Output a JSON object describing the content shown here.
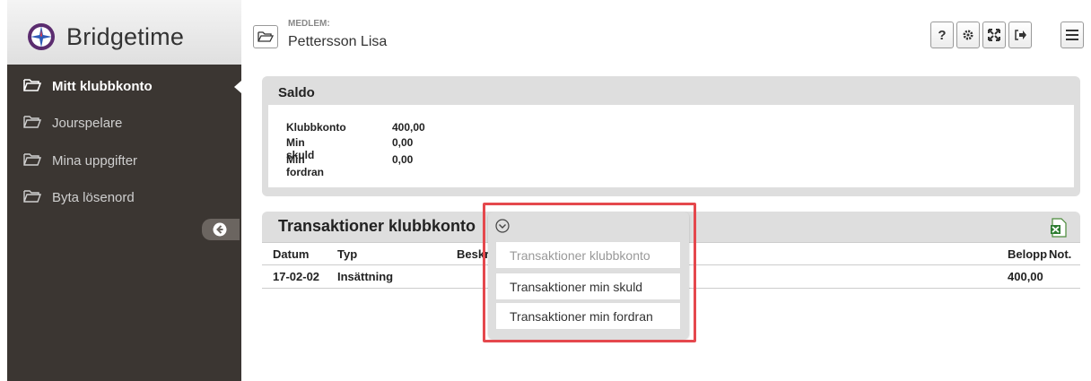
{
  "app": {
    "name": "Bridgetime"
  },
  "member": {
    "label": "MEDLEM:",
    "name": "Pettersson Lisa"
  },
  "toolbar": {
    "help_label": "?"
  },
  "sidebar": {
    "items": [
      {
        "label": "Mitt klubbkonto",
        "active": true
      },
      {
        "label": "Jourspelare"
      },
      {
        "label": "Mina uppgifter"
      },
      {
        "label": "Byta lösenord"
      }
    ]
  },
  "saldo": {
    "title": "Saldo",
    "rows": [
      {
        "label": "Klubbkonto",
        "value": "400,00"
      },
      {
        "label": "Min skuld",
        "value": "0,00"
      },
      {
        "label": "Min fordran",
        "value": "0,00"
      }
    ]
  },
  "transactions": {
    "title": "Transaktioner klubbkonto",
    "columns": {
      "date": "Datum",
      "type": "Typ",
      "desc": "Beskr",
      "amount": "Belopp",
      "note": "Not."
    },
    "rows": [
      {
        "date": "17-02-02",
        "type": "Insättning",
        "amount": "400,00"
      }
    ]
  },
  "dropdown": {
    "items": [
      {
        "label": "Transaktioner klubbkonto",
        "disabled": true
      },
      {
        "label": "Transaktioner min skuld"
      },
      {
        "label": "Transaktioner min fordran"
      }
    ]
  },
  "colors": {
    "sidebar_bg": "#3b3632",
    "highlight": "#e5484d",
    "panel_bg": "#dedede"
  }
}
